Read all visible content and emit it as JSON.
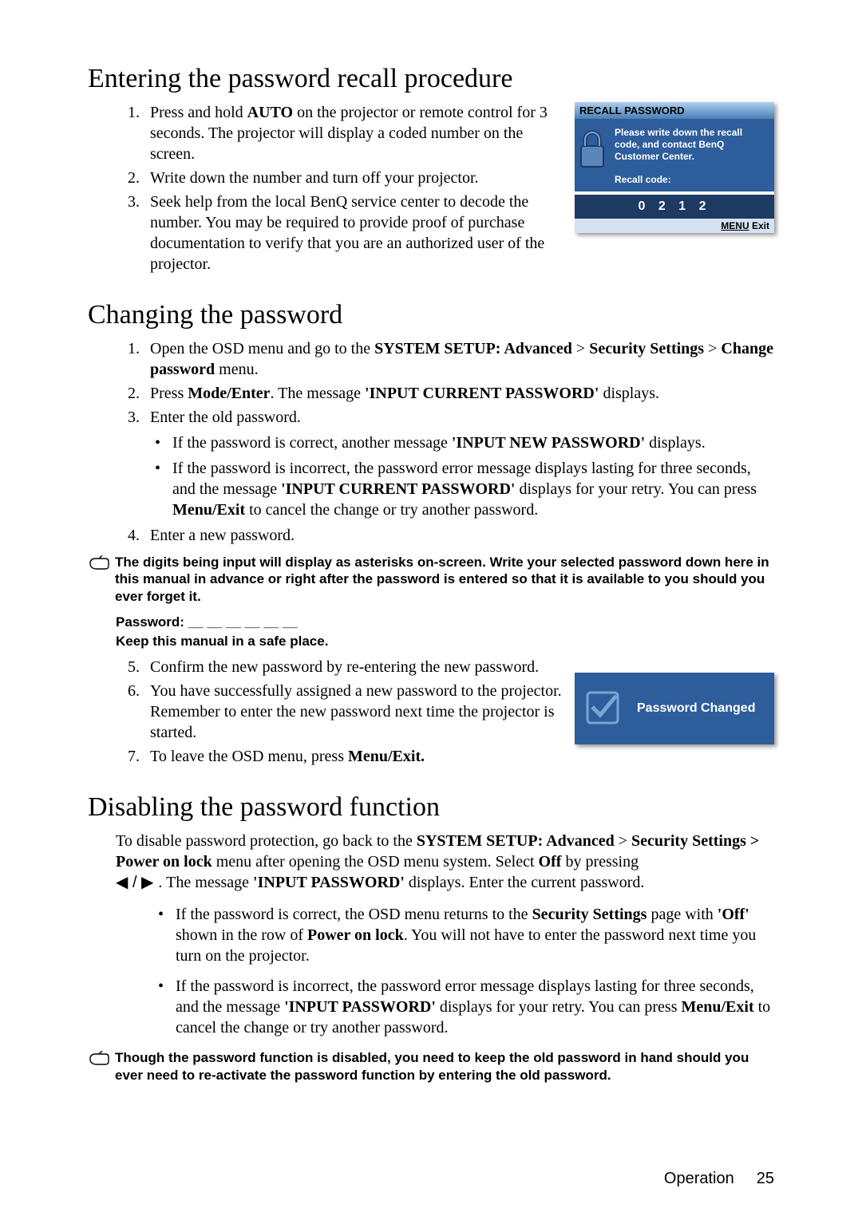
{
  "section1": {
    "heading": "Entering the password recall procedure",
    "steps": [
      "Press and hold AUTO on the projector or remote control for 3 seconds. The projector will display a coded number on the screen.",
      "Write down the number and turn off your projector.",
      "Seek help from the local BenQ service center to decode the number. You may be required to provide proof of purchase documentation to verify that you are an authorized user of the projector."
    ]
  },
  "recall_box": {
    "header": "RECALL PASSWORD",
    "msg": "Please write down the recall code, and contact BenQ Customer Center.",
    "code_label": "Recall code:",
    "code": "0 2 1 2",
    "footer_left": "MENU",
    "footer_right": "Exit"
  },
  "section2": {
    "heading": "Changing the password",
    "step1_a": "Open the OSD menu and go to the ",
    "step1_b": "SYSTEM SETUP: Advanced",
    "step1_c": " > ",
    "step1_d": "Security Settings",
    "step1_e": " > ",
    "step1_f": "Change password",
    "step1_g": " menu.",
    "step2_a": "Press ",
    "step2_b": "Mode/Enter",
    "step2_c": ". The message ",
    "step2_d": "'INPUT CURRENT PASSWORD'",
    "step2_e": " displays.",
    "step3": "Enter the old password.",
    "sub3a_a": "If the password is correct, another message ",
    "sub3a_b": "'INPUT NEW PASSWORD'",
    "sub3a_c": " displays.",
    "sub3b_a": "If the password is incorrect, the password error message displays lasting for three seconds, and the message ",
    "sub3b_b": "'INPUT CURRENT PASSWORD'",
    "sub3b_c": " displays for your retry. You can press ",
    "sub3b_d": "Menu/Exit",
    "sub3b_e": " to cancel the change or try another password.",
    "step4": "Enter a new password.",
    "note1": "The digits being input will display as asterisks on-screen. Write your selected password down here in this manual in advance or right after the password is entered so that it is available to you should you ever forget it.",
    "pw_line": "Password: __ __ __ __ __ __",
    "keep_line": "Keep this manual in a safe place.",
    "step5": "Confirm the new password by re-entering the new password.",
    "step6": "You have successfully assigned a new password to the projector. Remember to enter the new password next time the projector is started.",
    "step7_a": "To leave the OSD menu, press ",
    "step7_b": "Menu/Exit."
  },
  "pwchanged_box": {
    "text": "Password Changed"
  },
  "section3": {
    "heading": "Disabling the password function",
    "para_a": "To disable password protection, go back to the ",
    "para_b": "SYSTEM SETUP: Advanced",
    "para_c": " > ",
    "para_d": "Security Settings > Power on lock",
    "para_e": " menu after opening the OSD menu system. Select ",
    "para_f": "Off",
    "para_g": " by pressing ",
    "para_arrows": "◀ / ▶ .",
    "para_h": " The message ",
    "para_i": "'INPUT PASSWORD'",
    "para_j": " displays. Enter the current password.",
    "sub1_a": "If the password is correct, the OSD menu returns to the ",
    "sub1_b": "Security Settings",
    "sub1_c": " page with ",
    "sub1_d": "'Off'",
    "sub1_e": " shown in the row of ",
    "sub1_f": "Power on lock",
    "sub1_g": ". You will not have to enter the password next time you turn on the projector.",
    "sub2_a": "If the password is incorrect, the password error message displays lasting for three seconds, and the message ",
    "sub2_b": "'INPUT PASSWORD'",
    "sub2_c": " displays for your retry. You can press ",
    "sub2_d": "Menu/Exit",
    "sub2_e": " to cancel the change or try another password.",
    "note2": "Though the password function is disabled, you need to keep the old password in hand should you ever need to re-activate the password function by entering the old password."
  },
  "footer": {
    "label": "Operation",
    "page": "25"
  }
}
